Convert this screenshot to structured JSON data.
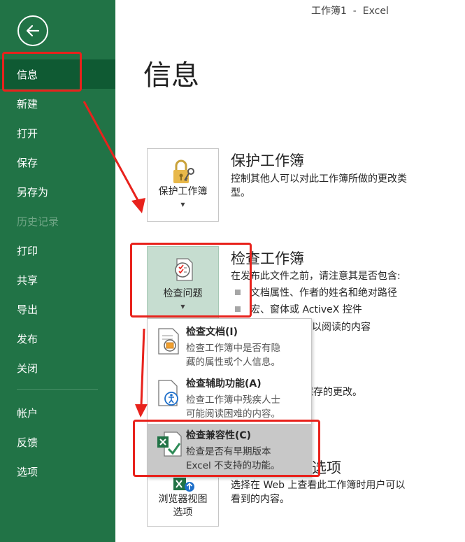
{
  "window": {
    "title": "工作簿1  -  Excel"
  },
  "sidebar": {
    "items": [
      {
        "label": "信息",
        "active": true
      },
      {
        "label": "新建"
      },
      {
        "label": "打开"
      },
      {
        "label": "保存"
      },
      {
        "label": "另存为"
      },
      {
        "label": "历史记录",
        "disabled": true
      },
      {
        "label": "打印"
      },
      {
        "label": "共享"
      },
      {
        "label": "导出"
      },
      {
        "label": "发布"
      },
      {
        "label": "关闭"
      },
      {
        "label": "帐户"
      },
      {
        "label": "反馈"
      },
      {
        "label": "选项"
      }
    ]
  },
  "main": {
    "page_title": "信息",
    "protect": {
      "button_label": "保护工作簿",
      "title": "保护工作簿",
      "desc_line1": "控制其他人可以对此工作簿所做的更改类",
      "desc_line2": "型。"
    },
    "inspect": {
      "button_label": "检查问题",
      "title": "检查工作簿",
      "desc": "在发布此文件之前，请注意其是否包含:",
      "bullets": [
        "文档属性、作者的姓名和绝对路径",
        "宏、窗体或 ActiveX 控件",
        "以阅读的内容"
      ]
    },
    "manage": {
      "partial_desc": "保存的更改。"
    },
    "browser": {
      "button_label_line1": "浏览器视图",
      "button_label_line2": "选项",
      "title_partial": "选项",
      "desc_line1": "选择在 Web 上查看此工作簿时用户可以",
      "desc_line2": "看到的内容。"
    }
  },
  "dropdown": {
    "items": [
      {
        "title": "检查文档(I)",
        "desc_line1": "检查工作簿中是否有隐",
        "desc_line2": "藏的属性或个人信息。"
      },
      {
        "title": "检查辅助功能(A)",
        "desc_line1": "检查工作簿中残疾人士",
        "desc_line2": "可能阅读困难的内容。"
      },
      {
        "title": "检查兼容性(C)",
        "desc_line1": "检查是否有早期版本",
        "desc_line2": "Excel 不支持的功能。",
        "hover": true
      }
    ]
  },
  "colors": {
    "sidebar": "#217346",
    "sidebar_active": "#0f5a33",
    "annotation": "#e8221c"
  }
}
